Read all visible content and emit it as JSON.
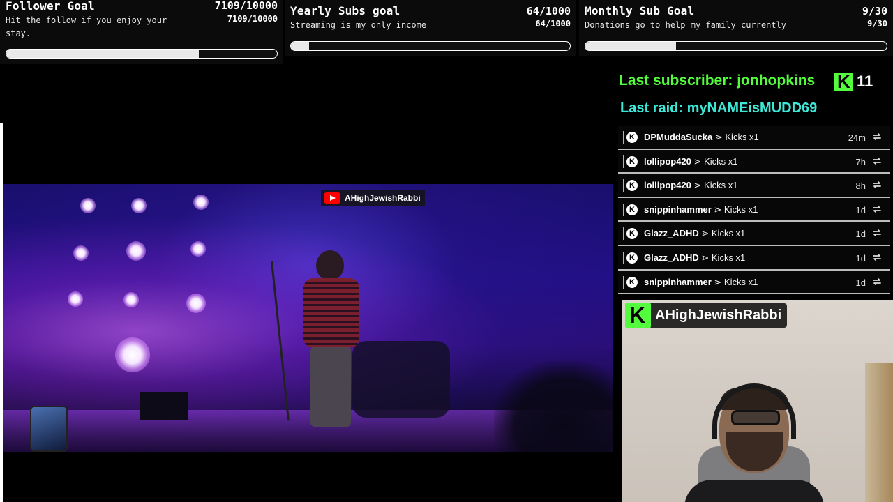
{
  "goals": [
    {
      "title": "Follower Goal",
      "count": "7109/10000",
      "description": "Hit the follow if you enjoy your stay.",
      "count_small": "7109/10000",
      "progress": 0.711
    },
    {
      "title": "Yearly Subs goal",
      "count": "64/1000",
      "description": "Streaming is my only income",
      "count_small": "64/1000",
      "progress": 0.064
    },
    {
      "title": "Monthly Sub Goal",
      "count": "9/30",
      "description": "Donations go to help my family currently",
      "count_small": "9/30",
      "progress": 0.3
    }
  ],
  "last_subscriber": "Last subscriber: jonhopkins",
  "sub_count": "11",
  "last_raid": "Last raid: myNAMEisMUDD69",
  "feed": [
    {
      "user": "DPMuddaSucka",
      "action": "⋗ Kicks x1",
      "time": "24m"
    },
    {
      "user": "lollipop420",
      "action": "⋗ Kicks x1",
      "time": "7h"
    },
    {
      "user": "lollipop420",
      "action": "⋗ Kicks x1",
      "time": "8h"
    },
    {
      "user": "snippinhammer",
      "action": "⋗ Kicks x1",
      "time": "1d"
    },
    {
      "user": "Glazz_ADHD",
      "action": "⋗ Kicks x1",
      "time": "1d"
    },
    {
      "user": "Glazz_ADHD",
      "action": "⋗ Kicks x1",
      "time": "1d"
    },
    {
      "user": "snippinhammer",
      "action": "⋗ Kicks x1",
      "time": "1d"
    }
  ],
  "video": {
    "watermark": "AHighJewishRabbi"
  },
  "webcam": {
    "name": "AHighJewishRabbi"
  },
  "icons": {
    "kick_badge": "K",
    "kick_logo": "K",
    "replay": "replay-icon",
    "youtube": "youtube-icon"
  },
  "colors": {
    "kick_green": "#53fc3c",
    "raid_cyan": "#3ee8d8"
  }
}
